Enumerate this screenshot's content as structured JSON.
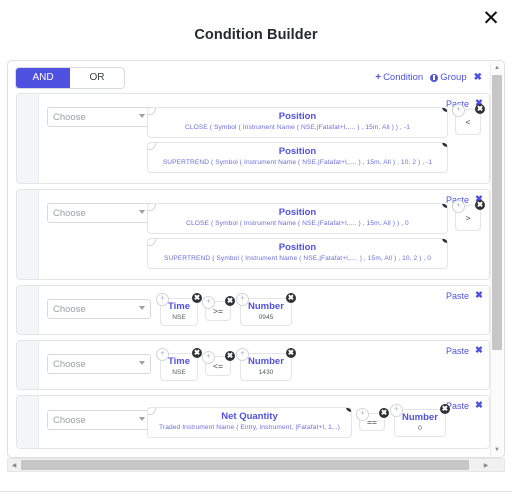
{
  "window": {
    "title": "Condition Builder",
    "close_label": "✕"
  },
  "logic": {
    "and_label": "AND",
    "or_label": "OR",
    "active": "AND"
  },
  "group_actions": {
    "condition_label": "Condition",
    "group_label": "Group",
    "remove_label": "✖",
    "plus_label": "+"
  },
  "common": {
    "choose_placeholder": "Choose",
    "paste_label": "Paste",
    "remove_label": "✖",
    "mini_add": "+",
    "mini_remove": "✖"
  },
  "accent_color": "#4f52e0",
  "rows": [
    {
      "id": "row-1",
      "type": "expression",
      "choose": "Choose",
      "paste": "Paste",
      "expressions": [
        {
          "title": "Position",
          "detail": "CLOSE ( Symbol ( Instrument Name ( NSE,|Fatafat+I,.... ) , 15m, All ) ) , -1"
        },
        {
          "title": "Position",
          "detail": "SUPERTREND ( Symbol ( Instrument Name ( NSE,|Fatafat+I,.... ) , 15m, All ) , 10, 2 ) , -1"
        }
      ],
      "operator": "<"
    },
    {
      "id": "row-2",
      "type": "expression",
      "choose": "Choose",
      "paste": "Paste",
      "expressions": [
        {
          "title": "Position",
          "detail": "CLOSE ( Symbol ( Instrument Name ( NSE,|Fatafat+I,.... ) , 15m, All ) ) , 0"
        },
        {
          "title": "Position",
          "detail": "SUPERTREND ( Symbol ( Instrument Name ( NSE,|Fatafat+I,.... ) , 15m, All ) , 10, 2 ) , 0"
        }
      ],
      "operator": ">"
    },
    {
      "id": "row-3",
      "type": "simple",
      "choose": "Choose",
      "paste": "Paste",
      "left": {
        "title": "Time",
        "value": "NSE"
      },
      "operator": ">=",
      "right": {
        "title": "Number",
        "value": "0945"
      }
    },
    {
      "id": "row-4",
      "type": "simple",
      "choose": "Choose",
      "paste": "Paste",
      "left": {
        "title": "Time",
        "value": "NSE"
      },
      "operator": "<=",
      "right": {
        "title": "Number",
        "value": "1430"
      }
    },
    {
      "id": "row-5",
      "type": "wide",
      "choose": "Choose",
      "paste": "Paste",
      "left": {
        "title": "Net Quantity",
        "detail": "Traded Instrument Name ( Entry, instrument, |Fatafat+I, 1,..)"
      },
      "operator": "==",
      "right": {
        "title": "Number",
        "value": "0"
      }
    }
  ],
  "scrollbars": {
    "v_up": "▲",
    "v_down": "▼",
    "h_left": "◀",
    "h_right": "▶"
  }
}
